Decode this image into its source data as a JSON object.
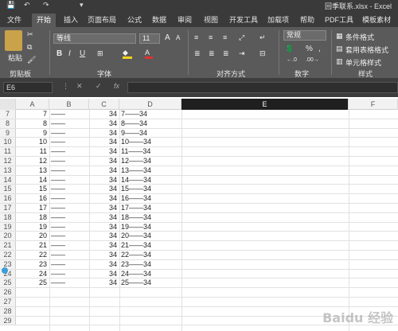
{
  "titlebar": {
    "title": "回季联系.xlsx - Excel",
    "qa_save": "💾",
    "qa_undo": "↶",
    "qa_redo": "↷",
    "qa_more": "▾"
  },
  "tabs": [
    "文件",
    "开始",
    "插入",
    "页面布局",
    "公式",
    "数据",
    "审阅",
    "视图",
    "开发工具",
    "加载项",
    "帮助",
    "PDF工具",
    "模板素材"
  ],
  "active_tab": "开始",
  "ribbon": {
    "clipboard": {
      "paste": "粘贴",
      "label": "剪贴板"
    },
    "font": {
      "name": "等线",
      "size": "11",
      "bold": "B",
      "italic": "I",
      "underline": "U",
      "label": "字体",
      "grow": "A",
      "shrink": "A"
    },
    "alignment": {
      "label": "对齐方式"
    },
    "number": {
      "format": "常规",
      "percent": "%",
      "comma": ",",
      "label": "数字"
    },
    "styles": {
      "conditional": "条件格式",
      "table": "套用表格格式",
      "cell": "单元格样式",
      "label": "样式"
    }
  },
  "formula_bar": {
    "name_box": "E6",
    "cancel": "✕",
    "enter": "✓",
    "fx": "fx",
    "value": ""
  },
  "columns": [
    "A",
    "B",
    "C",
    "D",
    "E",
    "F"
  ],
  "selected_column": "E",
  "rows": [
    {
      "n": "7",
      "a": "7",
      "b": "——",
      "c": "34",
      "d": "7——34"
    },
    {
      "n": "8",
      "a": "8",
      "b": "——",
      "c": "34",
      "d": "8——34"
    },
    {
      "n": "9",
      "a": "9",
      "b": "——",
      "c": "34",
      "d": "9——34"
    },
    {
      "n": "10",
      "a": "10",
      "b": "——",
      "c": "34",
      "d": "10——34"
    },
    {
      "n": "11",
      "a": "11",
      "b": "——",
      "c": "34",
      "d": "11——34"
    },
    {
      "n": "12",
      "a": "12",
      "b": "——",
      "c": "34",
      "d": "12——34"
    },
    {
      "n": "13",
      "a": "13",
      "b": "——",
      "c": "34",
      "d": "13——34"
    },
    {
      "n": "14",
      "a": "14",
      "b": "——",
      "c": "34",
      "d": "14——34"
    },
    {
      "n": "15",
      "a": "15",
      "b": "——",
      "c": "34",
      "d": "15——34"
    },
    {
      "n": "16",
      "a": "16",
      "b": "——",
      "c": "34",
      "d": "16——34"
    },
    {
      "n": "17",
      "a": "17",
      "b": "——",
      "c": "34",
      "d": "17——34"
    },
    {
      "n": "18",
      "a": "18",
      "b": "——",
      "c": "34",
      "d": "18——34"
    },
    {
      "n": "19",
      "a": "19",
      "b": "——",
      "c": "34",
      "d": "19——34"
    },
    {
      "n": "20",
      "a": "20",
      "b": "——",
      "c": "34",
      "d": "20——34"
    },
    {
      "n": "21",
      "a": "21",
      "b": "——",
      "c": "34",
      "d": "21——34"
    },
    {
      "n": "22",
      "a": "22",
      "b": "——",
      "c": "34",
      "d": "22——34"
    },
    {
      "n": "23",
      "a": "23",
      "b": "——",
      "c": "34",
      "d": "23——34"
    },
    {
      "n": "24",
      "a": "24",
      "b": "——",
      "c": "34",
      "d": "24——34"
    },
    {
      "n": "25",
      "a": "25",
      "b": "——",
      "c": "34",
      "d": "25——34"
    },
    {
      "n": "26",
      "a": "",
      "b": "",
      "c": "",
      "d": ""
    },
    {
      "n": "27",
      "a": "",
      "b": "",
      "c": "",
      "d": ""
    },
    {
      "n": "28",
      "a": "",
      "b": "",
      "c": "",
      "d": ""
    },
    {
      "n": "29",
      "a": "",
      "b": "",
      "c": "",
      "d": ""
    }
  ],
  "watermark": "Baidu 经验"
}
